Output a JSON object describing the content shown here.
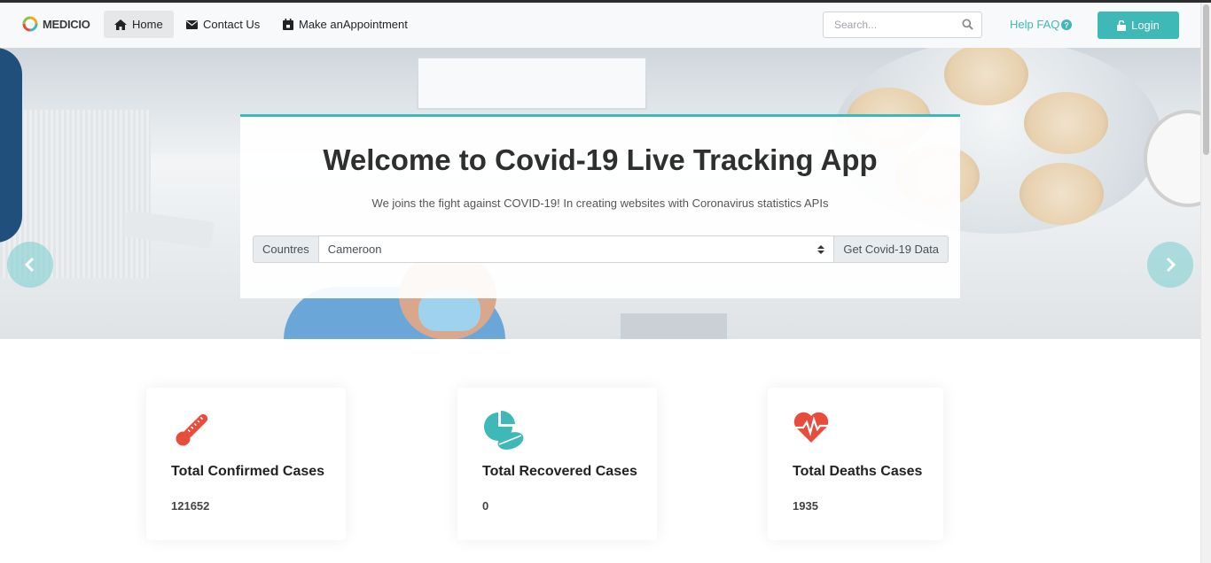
{
  "brand": {
    "name": "MEDICIO"
  },
  "nav": {
    "items": [
      {
        "label": "Home",
        "icon": "home-icon",
        "active": true
      },
      {
        "label": "Contact Us",
        "icon": "envelope-icon",
        "active": false
      },
      {
        "label": "Make anAppointment",
        "icon": "calendar-icon",
        "active": false
      }
    ],
    "search_placeholder": "Search...",
    "help_label": "Help FAQ",
    "login_label": "Login"
  },
  "hero": {
    "title": "Welcome to Covid-19 Live Tracking App",
    "subtitle": "We joins the fight against COVID-19! In creating websites with Coronavirus statistics APIs",
    "country_addon": "Countres",
    "selected_country": "Cameroon",
    "submit_label": "Get Covid-19 Data"
  },
  "stats": [
    {
      "title": "Total Confirmed Cases",
      "value": "121652",
      "icon": "thermometer-icon"
    },
    {
      "title": "Total Recovered Cases",
      "value": "0",
      "icon": "pills-icon"
    },
    {
      "title": "Total Deaths Cases",
      "value": "1935",
      "icon": "heartbeat-icon"
    }
  ],
  "colors": {
    "accent": "#3fb8b8",
    "icon_red": "#e84c3d",
    "icon_teal": "#3fb8b8"
  }
}
